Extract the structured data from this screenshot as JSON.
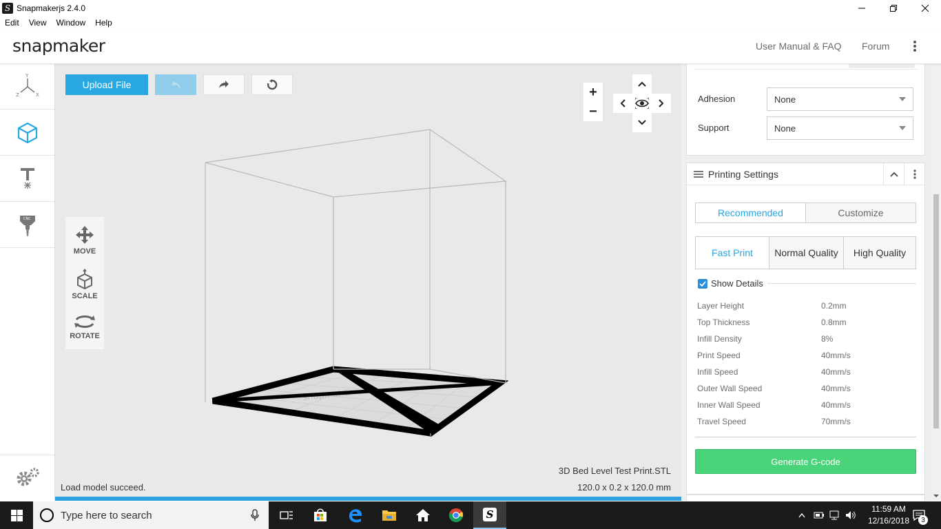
{
  "window": {
    "title": "Snapmakerjs 2.4.0",
    "app_icon": "S"
  },
  "menu": [
    "Edit",
    "View",
    "Window",
    "Help"
  ],
  "header": {
    "logo": "snapmaker",
    "manual_link": "User Manual & FAQ",
    "forum_link": "Forum"
  },
  "sidebar": {
    "items": [
      "axes-icon",
      "3d-print-icon",
      "laser-icon",
      "cnc-icon"
    ],
    "active_index": 1,
    "settings": "gear-icon"
  },
  "toolbar": {
    "upload_label": "Upload File"
  },
  "tools": {
    "move": "MOVE",
    "scale": "SCALE",
    "rotate": "ROTATE"
  },
  "zoom": {
    "in": "+",
    "out": "−"
  },
  "status": {
    "message": "Load model succeed.",
    "file_name": "3D Bed Level Test Print.STL",
    "dimensions": "120.0 x 0.2 x 120.0 mm",
    "progress": 1.0
  },
  "material": {
    "adhesion_label": "Adhesion",
    "adhesion_value": "None",
    "support_label": "Support",
    "support_value": "None"
  },
  "printing_settings": {
    "title": "Printing Settings",
    "mode_tabs": [
      "Recommended",
      "Customize"
    ],
    "quality_tabs": [
      "Fast Print",
      "Normal Quality",
      "High Quality"
    ],
    "show_details_label": "Show Details",
    "show_details_checked": true,
    "details": [
      {
        "key": "Layer Height",
        "value": "0.2mm"
      },
      {
        "key": "Top Thickness",
        "value": "0.8mm"
      },
      {
        "key": "Infill Density",
        "value": "8%"
      },
      {
        "key": "Print Speed",
        "value": "40mm/s"
      },
      {
        "key": "Infill Speed",
        "value": "40mm/s"
      },
      {
        "key": "Outer Wall Speed",
        "value": "40mm/s"
      },
      {
        "key": "Inner Wall Speed",
        "value": "40mm/s"
      },
      {
        "key": "Travel Speed",
        "value": "70mm/s"
      }
    ],
    "generate_label": "Generate G-code"
  },
  "taskbar": {
    "search_placeholder": "Type here to search",
    "time": "11:59 AM",
    "date": "12/16/2018",
    "notification_count": "3"
  },
  "colors": {
    "accent": "#28a7e1",
    "generate": "#4ad47a",
    "taskbar": "#1b1b1b"
  }
}
